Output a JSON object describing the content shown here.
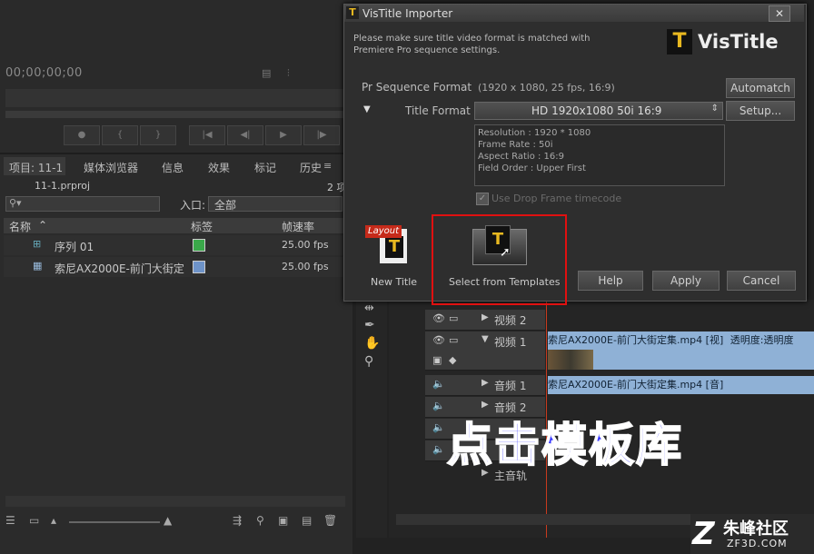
{
  "monitor": {
    "timecode": "00;00;00;00"
  },
  "project": {
    "tabs": [
      "项目: 11-1",
      "媒体浏览器",
      "信息",
      "效果",
      "标记",
      "历史"
    ],
    "file": "11-1.prproj",
    "count": "2 项",
    "inpoint_label": "入口:",
    "inpoint_value": "全部",
    "columns": [
      "名称",
      "标签",
      "帧速率"
    ],
    "items": [
      {
        "name": "序列 01",
        "fps": "25.00 fps",
        "color": "#3aa84a"
      },
      {
        "name": "索尼AX2000E-前门大街定",
        "fps": "25.00 fps",
        "color": "#6e93c8"
      }
    ]
  },
  "dialog": {
    "title": "VisTitle Importer",
    "notice": "Please make sure title video format is matched with Premiere Pro sequence settings.",
    "logo": "VisTitle",
    "seq_label": "Pr Sequence Format",
    "seq_value": "(1920 x 1080, 25 fps, 16:9)",
    "automatch": "Automatch",
    "title_format_label": "Title Format",
    "title_format_value": "HD 1920x1080 50i 16:9",
    "setup": "Setup...",
    "info": [
      "Resolution : 1920 * 1080",
      "Frame Rate : 50i",
      "Aspect Ratio : 16:9",
      "Field Order : Upper First"
    ],
    "drop_frame": "Use Drop Frame timecode",
    "new_title": "New Title",
    "layout_badge": "Layout",
    "templates": "Select from Templates",
    "help": "Help",
    "apply": "Apply",
    "cancel": "Cancel"
  },
  "timeline": {
    "tracks": [
      {
        "name": "视频 2"
      },
      {
        "name": "视频 1"
      },
      {
        "name": "音频 1"
      },
      {
        "name": "音频 2"
      }
    ],
    "partial_track": "主音轨",
    "video_clip": "索尼AX2000E-前门大街定集.mp4 [视]",
    "video_clip_opacity": "透明度:透明度",
    "audio_clip": "索尼AX2000E-前门大街定集.mp4 [音]"
  },
  "overlay_text": "点击模板库",
  "watermark": {
    "brand": "朱峰社区",
    "url": "ZF3D.COM"
  }
}
